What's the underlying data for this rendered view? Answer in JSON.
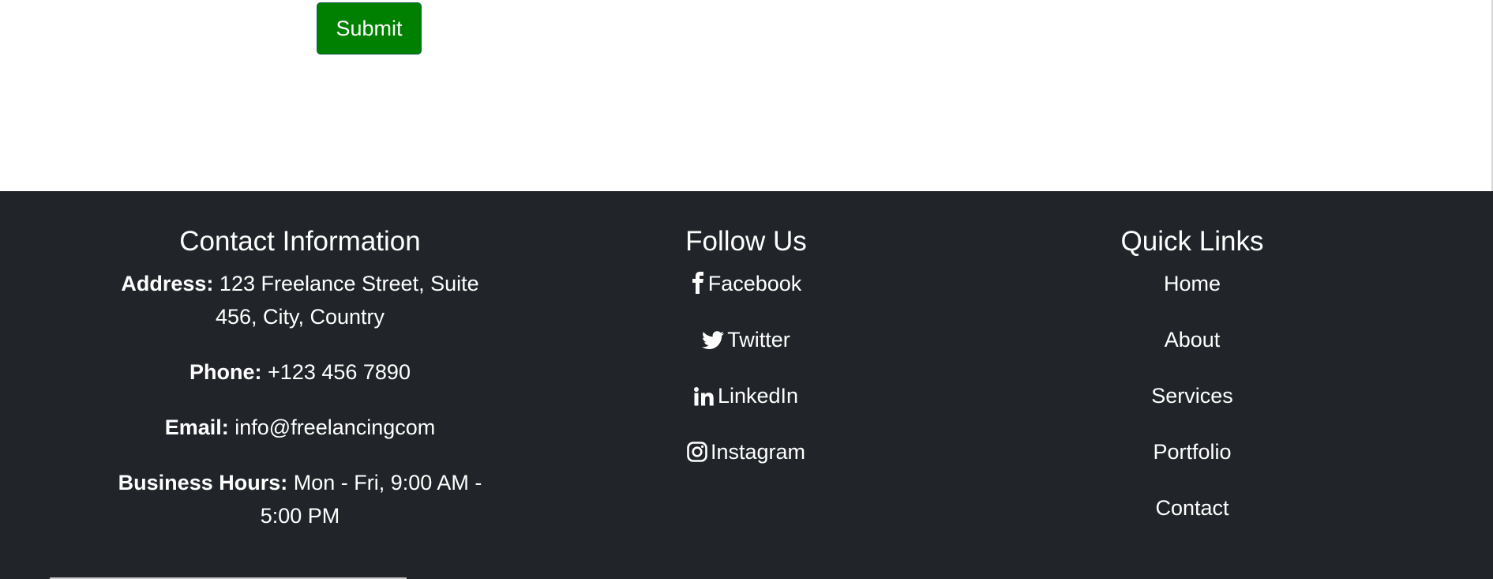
{
  "form": {
    "submit_label": "Submit"
  },
  "footer": {
    "contact": {
      "heading": "Contact Information",
      "address_label": "Address:",
      "address_value": "123 Freelance Street, Suite 456, City, Country",
      "phone_label": "Phone:",
      "phone_value": "+123 456 7890",
      "email_label": "Email:",
      "email_value": "info@freelancingcom",
      "hours_label": "Business Hours:",
      "hours_value": "Mon - Fri, 9:00 AM - 5:00 PM"
    },
    "follow": {
      "heading": "Follow Us",
      "items": [
        {
          "label": "Facebook",
          "icon": "facebook-icon"
        },
        {
          "label": "Twitter",
          "icon": "twitter-icon"
        },
        {
          "label": "LinkedIn",
          "icon": "linkedin-icon"
        },
        {
          "label": "Instagram",
          "icon": "instagram-icon"
        }
      ]
    },
    "quick_links": {
      "heading": "Quick Links",
      "items": [
        "Home",
        "About",
        "Services",
        "Portfolio",
        "Contact"
      ]
    }
  },
  "colors": {
    "submit_bg": "#008000",
    "footer_bg": "#212529",
    "text": "#ffffff"
  }
}
